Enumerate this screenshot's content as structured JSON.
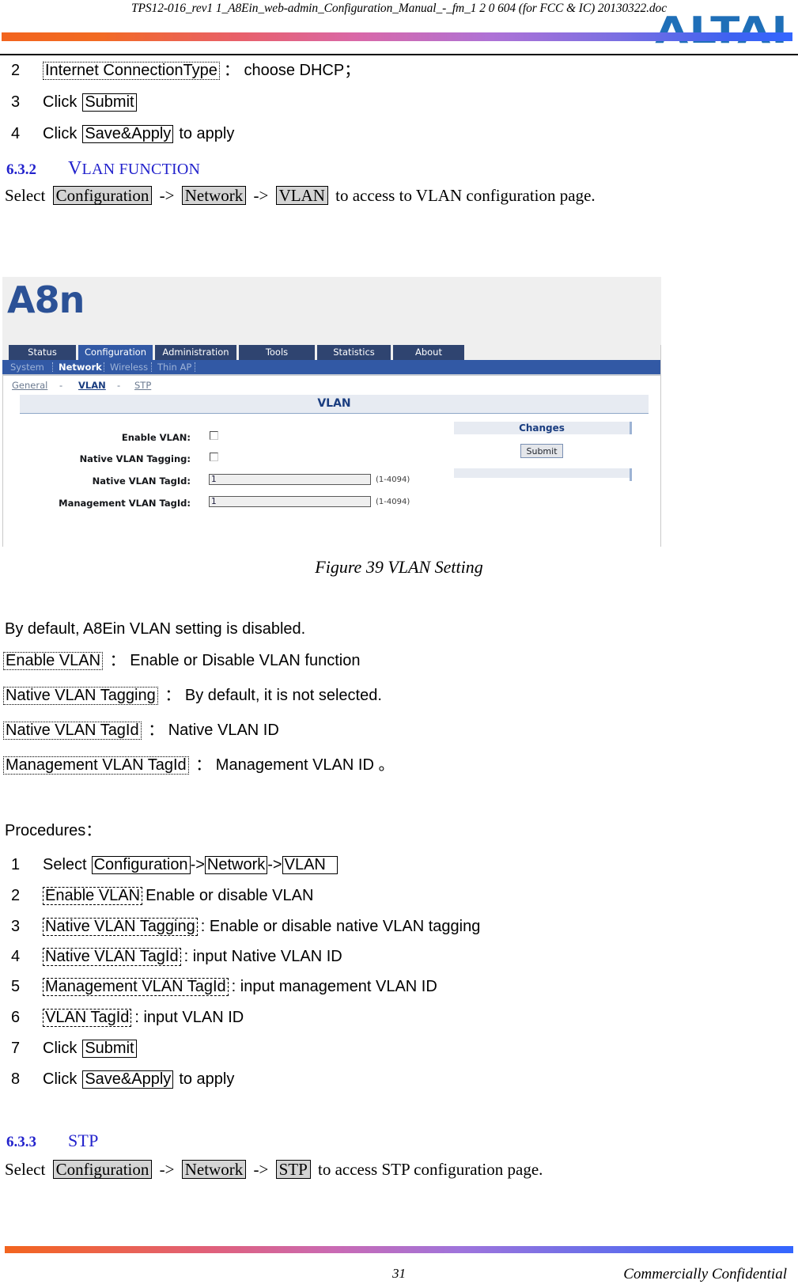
{
  "header": {
    "doc_title": "TPS12-016_rev1 1_A8Ein_web-admin_Configuration_Manual_-_fm_1 2 0 604 (for FCC & IC) 20130322.doc",
    "logo_text": "ALTAI"
  },
  "top_steps": [
    {
      "num": "2",
      "token": "Internet ConnectionType",
      "tail": "： choose DHCP；"
    },
    {
      "num": "3",
      "lead": "Click",
      "token": "Submit",
      "tail": ""
    },
    {
      "num": "4",
      "lead": "Click",
      "token": "Save&Apply",
      "tail": "to apply"
    }
  ],
  "section_vlan": {
    "number": "6.3.2",
    "title_first": "V",
    "title_rest": "LAN FUNCTION",
    "intro_lead": "Select",
    "intro_token1": "Configuration",
    "intro_arrow1": "->",
    "intro_token2": "Network",
    "intro_arrow2": "->",
    "intro_token3": "VLAN",
    "intro_tail": "to access to VLAN configuration page."
  },
  "screenshot": {
    "brand": "A8n",
    "tabs": [
      {
        "label": "Status",
        "active": false
      },
      {
        "label": "Configuration",
        "active": true
      },
      {
        "label": "Administration",
        "active": false
      },
      {
        "label": "Tools",
        "active": false
      },
      {
        "label": "Statistics",
        "active": false
      },
      {
        "label": "About",
        "active": false
      }
    ],
    "subnav": [
      {
        "label": "System",
        "active": false
      },
      {
        "label": "Network",
        "active": true
      },
      {
        "label": "Wireless",
        "active": false
      },
      {
        "label": "Thin AP",
        "active": false
      }
    ],
    "breadcrumb": [
      {
        "label": "General",
        "active": false
      },
      {
        "label": "VLAN",
        "active": true
      },
      {
        "label": "STP",
        "active": false
      }
    ],
    "breadcrumb_sep": "-",
    "panel_title": "VLAN",
    "fields": [
      {
        "label": "Enable VLAN:",
        "type": "checkbox",
        "checked": false
      },
      {
        "label": "Native VLAN Tagging:",
        "type": "checkbox",
        "checked": false
      },
      {
        "label": "Native VLAN TagId:",
        "type": "text",
        "value": "1",
        "hint": "(1-4094)"
      },
      {
        "label": "Management VLAN TagId:",
        "type": "text",
        "value": "1",
        "hint": "(1-4094)"
      }
    ],
    "changes_label": "Changes",
    "submit_label": "Submit",
    "colors": {
      "tab_inactive": "#2F4470",
      "tab_active": "#3259A5",
      "subbar": "#3259A5",
      "panel_header": "#E7EBF2",
      "title_blue": "#1A3D80"
    }
  },
  "figure_caption": "Figure 39 VLAN Setting",
  "description": {
    "intro": "By default, A8Ein VLAN setting is disabled.",
    "items": [
      {
        "token": "Enable VLAN",
        "tail": "： Enable or Disable VLAN function"
      },
      {
        "token": "Native VLAN Tagging",
        "tail": "： By default, it is not selected."
      },
      {
        "token": "Native VLAN TagId",
        "tail": "： Native VLAN ID"
      },
      {
        "token": "Management VLAN TagId",
        "tail": "： Management VLAN ID 。"
      }
    ]
  },
  "procedures": {
    "heading": "Procedures：",
    "steps": [
      {
        "num": "1",
        "lead": "Select",
        "token": "Configuration",
        "arrow1": "->",
        "token2": "Network",
        "arrow2": "->",
        "token3": "VLAN",
        "style": "chain"
      },
      {
        "num": "2",
        "token": "Enable VLAN",
        "tail": "Enable or disable VLAN",
        "style": "dashed"
      },
      {
        "num": "3",
        "token": "Native VLAN Tagging",
        "tail": ": Enable or disable native VLAN tagging",
        "style": "dashed"
      },
      {
        "num": "4",
        "token": "Native VLAN TagId",
        "tail": ": input Native VLAN ID",
        "style": "dashed"
      },
      {
        "num": "5",
        "token": "Management VLAN TagId",
        "tail": ": input management VLAN ID",
        "style": "dashed"
      },
      {
        "num": "6",
        "token": "VLAN TagId",
        "tail": ": input VLAN ID",
        "style": "dashed"
      },
      {
        "num": "7",
        "lead": "Click",
        "token": "Submit",
        "tail": "",
        "style": "solid"
      },
      {
        "num": "8",
        "lead": "Click",
        "token": "Save&Apply",
        "tail": "to apply",
        "style": "solid"
      }
    ]
  },
  "section_stp": {
    "number": "6.3.3",
    "title": "STP",
    "intro_lead": "Select",
    "intro_token1": "Configuration",
    "intro_arrow1": "->",
    "intro_token2": "Network",
    "intro_arrow2": "->",
    "intro_token3": "STP",
    "intro_tail": "to access STP configuration page."
  },
  "footer": {
    "page_number": "31",
    "confidential": "Commercially Confidential"
  }
}
